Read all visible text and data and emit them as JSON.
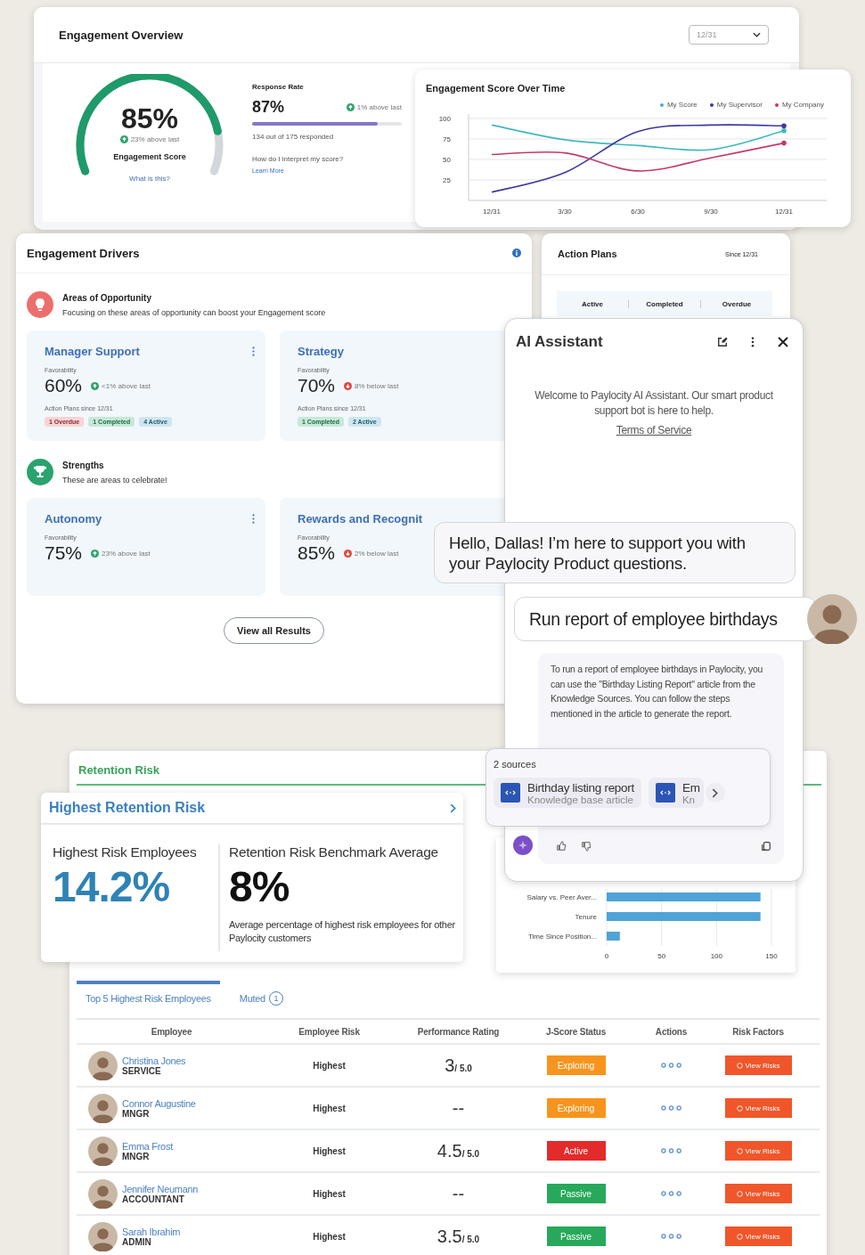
{
  "overview": {
    "title": "Engagement Overview",
    "date_select": "12/31",
    "gauge": {
      "value": "85%",
      "trend": {
        "kind": "up",
        "text": "23% above last"
      },
      "label": "Engagement Score",
      "link": "What is this?"
    },
    "response": {
      "title": "Response Rate",
      "value": "87%",
      "trend": {
        "kind": "up",
        "text": "1% above last"
      },
      "level": 0.84,
      "detail": "134 out of 175 responded",
      "question": "How do I interpret my score?",
      "link": "Learn More"
    }
  },
  "score_chart": {
    "title": "Engagement Score Over Time",
    "chart_data": {
      "type": "line",
      "categories": [
        "12/31",
        "3/30",
        "6/30",
        "9/30",
        "12/31"
      ],
      "ylim": [
        0,
        100
      ],
      "grid": true,
      "yticks": [
        25,
        50,
        75,
        100
      ],
      "series": [
        {
          "name": "My Score",
          "color": "#3fb8bf",
          "values": [
            92,
            74,
            67,
            62,
            85
          ]
        },
        {
          "name": "My Supervisor",
          "color": "#3c3a9e",
          "values": [
            10,
            34,
            84,
            92,
            91
          ]
        },
        {
          "name": "My Company",
          "color": "#c23a6c",
          "values": [
            56,
            58,
            36,
            52,
            70
          ]
        }
      ]
    }
  },
  "drivers": {
    "title": "Engagement Drivers",
    "groups": [
      {
        "kind": "opportunity",
        "title": "Areas of Opportunity",
        "subtitle": "Focusing on these areas of opportunity can boost your Engagement score",
        "cards": [
          {
            "name": "Manager Support",
            "label": "Favorability",
            "value": "60%",
            "trend": {
              "kind": "up",
              "text": "<1% above last"
            },
            "plans_label": "Action Plans since 12/31",
            "chips": [
              {
                "kind": "overdue",
                "text": "1 Overdue"
              },
              {
                "kind": "completed",
                "text": "1 Completed"
              },
              {
                "kind": "active",
                "text": "4 Active"
              }
            ]
          },
          {
            "name": "Strategy",
            "label": "Favorability",
            "value": "70%",
            "trend": {
              "kind": "down",
              "text": "8% below last"
            },
            "plans_label": "Action Plans since 12/31",
            "chips": [
              {
                "kind": "completed",
                "text": "1 Completed"
              },
              {
                "kind": "active",
                "text": "2 Active"
              }
            ]
          }
        ]
      },
      {
        "kind": "strength",
        "title": "Strengths",
        "subtitle": "These are areas to celebrate!",
        "cards": [
          {
            "name": "Autonomy",
            "label": "Favorability",
            "value": "75%",
            "trend": {
              "kind": "up",
              "text": "23% above last"
            }
          },
          {
            "name": "Rewards and Recognit",
            "label": "Favorability",
            "value": "85%",
            "trend": {
              "kind": "down",
              "text": "2% below last"
            }
          }
        ]
      }
    ],
    "button": "View all Results"
  },
  "action_plans": {
    "title": "Action Plans",
    "since": "Since 12/31",
    "columns": [
      "Active",
      "Completed",
      "Overdue"
    ]
  },
  "assistant": {
    "title": "AI Assistant",
    "welcome": "Welcome to Paylocity AI Assistant. Our smart product support bot is here to help.",
    "terms": "Terms of Service",
    "messages": [
      {
        "kind": "bot",
        "text": "Hello, Dallas! I’m here to support you with your Paylocity Product questions."
      },
      {
        "kind": "user",
        "text": "Run report of employee birthdays"
      },
      {
        "kind": "answer",
        "text": "To run a report of employee birthdays in Paylocity, you can use the \"Birthday Listing Report\" article from the Knowledge Sources. You can follow the steps mentioned in the article to generate the report."
      }
    ],
    "sources": {
      "title": "2 sources",
      "items": [
        {
          "title": "Birthday listing report",
          "subtitle": "Knowledge base article"
        },
        {
          "title": "Em",
          "subtitle": "Kn"
        }
      ]
    }
  },
  "retention": {
    "title": "Retention Risk",
    "summary": {
      "title": "Highest Retention Risk",
      "stats": [
        {
          "kind": "highlight",
          "label": "Highest Risk Employees",
          "value": "14.2%"
        },
        {
          "kind": "plain",
          "label": "Retention Risk Benchmark Average",
          "value": "8%",
          "note": "Average percentage of highest risk employees for other Paylocity customers"
        }
      ]
    },
    "risk_chart": {
      "chart_data": {
        "type": "bar",
        "orientation": "horizontal",
        "categories": [
          "Salary vs. Peer Aver...",
          "Tenure",
          "Time Since Position..."
        ],
        "values": [
          140,
          140,
          12
        ],
        "xlim": [
          0,
          150
        ],
        "xticks": [
          0,
          50,
          100,
          150
        ]
      }
    },
    "tabs": [
      {
        "label": "Top 5 Highest Risk Employees",
        "selected": true
      },
      {
        "label": "Muted",
        "count": "1",
        "selected": false
      }
    ],
    "table": {
      "columns": [
        "Employee",
        "Employee Risk",
        "Performance Rating",
        "J-Score Status",
        "Actions",
        "Risk Factors"
      ],
      "rows": [
        {
          "name": "Christina Jones",
          "role": "SERVICE",
          "risk": "Highest",
          "rating": {
            "score": "3",
            "scale": "/ 5.0"
          },
          "status": {
            "label": "Exploring",
            "color": "#f7941d"
          },
          "risk_factors": "View Risks"
        },
        {
          "name": "Connor Augustine",
          "role": "MNGR",
          "risk": "Highest",
          "rating": {
            "score": "--"
          },
          "status": {
            "label": "Exploring",
            "color": "#f7941d"
          },
          "risk_factors": "View Risks"
        },
        {
          "name": "Emma Frost",
          "role": "MNGR",
          "risk": "Highest",
          "rating": {
            "score": "4.5",
            "scale": "/ 5.0"
          },
          "status": {
            "label": "Active",
            "color": "#e32b2b"
          },
          "risk_factors": "View Risks"
        },
        {
          "name": "Jennifer Neumann",
          "role": "ACCOUNTANT",
          "risk": "Highest",
          "rating": {
            "score": "--"
          },
          "status": {
            "label": "Passive",
            "color": "#27a85a"
          },
          "risk_factors": "View Risks"
        },
        {
          "name": "Sarah Ibrahim",
          "role": "ADMIN",
          "risk": "Highest",
          "rating": {
            "score": "3.5",
            "scale": "/ 5.0"
          },
          "status": {
            "label": "Passive",
            "color": "#27a85a"
          },
          "risk_factors": "View Risks"
        }
      ]
    }
  }
}
